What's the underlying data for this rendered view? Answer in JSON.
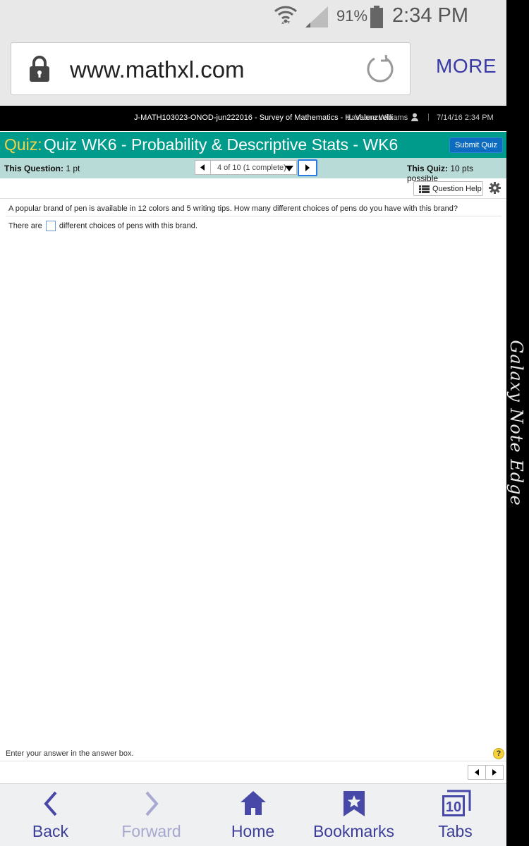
{
  "status_bar": {
    "battery_percent": "91%",
    "time": "2:34 PM",
    "icons": [
      "wifi-icon",
      "signal-icon",
      "battery-icon"
    ]
  },
  "browser": {
    "url": "www.mathxl.com",
    "more_label": "MORE",
    "accent_color": "#3a3aa6"
  },
  "course_bar": {
    "title": "J-MATH103023-ONOD-jun222016 - Survey of Mathematics - H. Valenzuela",
    "user": "Lashana Williams",
    "separator": "|",
    "datetime": "7/14/16 2:34 PM"
  },
  "quiz": {
    "prefix": "Quiz:",
    "title": "Quiz WK6 - Probability & Descriptive Stats - WK6",
    "submit_label": "Submit Quiz",
    "bar_color": "#009b8b"
  },
  "question_bar": {
    "this_question_label": "This Question:",
    "this_question_value": "1 pt",
    "position": "4 of 10 (1 complete)",
    "this_quiz_label": "This Quiz:",
    "this_quiz_value": "10 pts possible"
  },
  "help": {
    "question_help_label": "Question Help"
  },
  "question": {
    "text": "A popular brand of pen is available in 12 colors and 5 writing tips.  How many different choices of pens do you have with this brand?",
    "answer_prefix": "There are",
    "answer_value": "",
    "answer_suffix": "different choices of pens with this brand."
  },
  "footer": {
    "hint": "Enter your answer in the answer box.",
    "help_symbol": "?"
  },
  "bottom_nav": {
    "back": "Back",
    "forward": "Forward",
    "home": "Home",
    "bookmarks": "Bookmarks",
    "tabs": "Tabs",
    "tab_count": "10"
  },
  "device": {
    "edge_label": "Galaxy Note Edge"
  }
}
